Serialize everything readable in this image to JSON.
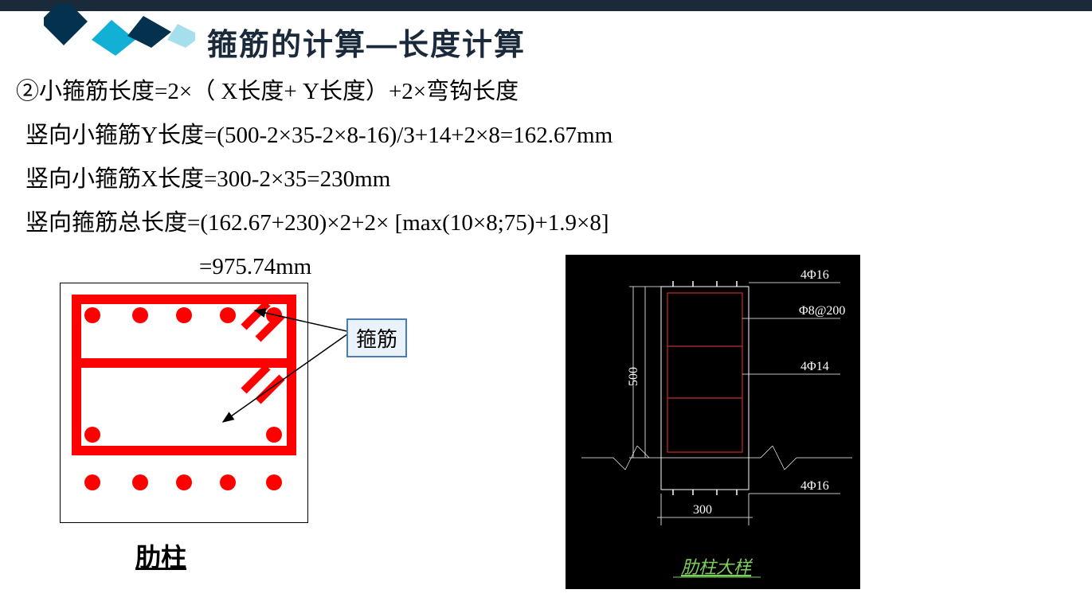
{
  "title": "箍筋的计算—长度计算",
  "lines": {
    "l1": "②小箍筋长度=2×（ X长度+ Y长度）+2×弯钩长度",
    "l2": "竖向小箍筋Y长度=(500-2×35-2×8-16)/3+14+2×8=162.67mm",
    "l3": "竖向小箍筋X长度=300-2×35=230mm",
    "l4": "竖向箍筋总长度=(162.67+230)×2+2× [max(10×8;75)+1.9×8]",
    "l5": "=975.74mm"
  },
  "stirrup_label": "箍筋",
  "left_caption": "肋柱",
  "right_diagram": {
    "labels": {
      "top": "4Φ16",
      "second": "Φ8@200",
      "middle": "4Φ14",
      "bottom": "4Φ16",
      "dim_y": "500",
      "dim_x": "300"
    },
    "caption": "肋柱大样"
  }
}
